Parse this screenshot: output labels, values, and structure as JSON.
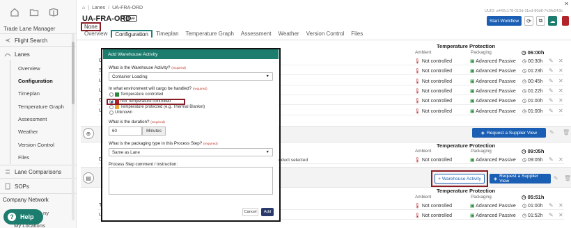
{
  "sidebar": {
    "app_title": "Trade Lane Manager",
    "flight_search": "Flight Search",
    "lanes": "Lanes",
    "sub_items": [
      "Overview",
      "Configuration",
      "Timeplan",
      "Temperature Graph",
      "Assessment",
      "Weather",
      "Version Control",
      "Files"
    ],
    "lane_comparisons": "Lane Comparisons",
    "sops": "SOPs",
    "company_network": "Company Network",
    "partial_1": "ny",
    "my_locations": "My Locations",
    "help": "Help"
  },
  "header": {
    "breadcrumb_root": "Lanes",
    "breadcrumb_current": "UA-FRA-ORD",
    "uuid": "UUID: a442c178-010d-11ed-80d6-7e3fe543b",
    "title": "UA-FRA-ORD",
    "status_badge": "Active",
    "none_label": "None",
    "start_workflow": "Start Workflow"
  },
  "tabs": [
    "Overview",
    "Configuration",
    "Timeplan",
    "Temperature Graph",
    "Assessment",
    "Weather",
    "Version Control",
    "Files"
  ],
  "table": {
    "temp_protection": "Temperature Protection",
    "ambient": "Ambient",
    "packaging": "Packaging",
    "header_time_1": "06:00h",
    "header_time_2": "09:05h",
    "header_time_3": "05:51h",
    "not_controlled": "Not controlled",
    "advanced_passive": "Advanced Passive",
    "rows_1": [
      {
        "label": "O",
        "time": "00:30h"
      },
      {
        "label": "S",
        "time": "01:23h"
      },
      {
        "label": "U",
        "time": "00:45h"
      },
      {
        "label": "U",
        "time": "01:22h"
      },
      {
        "label": "C",
        "time": "01:00h"
      },
      {
        "label": "U",
        "time": "01:00h"
      }
    ],
    "rows_2": [
      {
        "label": "D",
        "time": "09:05h"
      }
    ],
    "rows_3": [
      {
        "label": "T",
        "time": "01:00h"
      },
      {
        "label": "U",
        "time": "01:52h"
      }
    ],
    "product_selected": "roduct selected",
    "request_supplier_view": "Request a Supplier View",
    "warehouse_activity": "+ Warehouse Activity"
  },
  "modal": {
    "title": "Add Warehouse Activity",
    "q_activity": "What is the Warehouse Activity?",
    "required": "(required)",
    "activity_value": "Container Loading",
    "q_environment": "In what environment will cargo be handled?",
    "options": [
      "Temperature controlled",
      "Not Temperature controlled",
      "Temperature protected (e.g. Thermal Blanket)",
      "Unknown"
    ],
    "selected_option": "Not Temperature controlled",
    "q_duration": "What is the duration?",
    "duration_value": "60",
    "duration_unit": "Minutes",
    "q_packaging": "What is the packaging type in this Process Step?",
    "packaging_value": "Same as Lane",
    "q_comment": "Process Step comment / instruction:",
    "cancel": "Cancel",
    "add": "Add"
  },
  "colors": {
    "teal": "#1c7c6d",
    "blue": "#1a5fb4",
    "highlight": "#8b1a24",
    "not_controlled": "#b3232b",
    "passive": "#2a8a3a"
  }
}
